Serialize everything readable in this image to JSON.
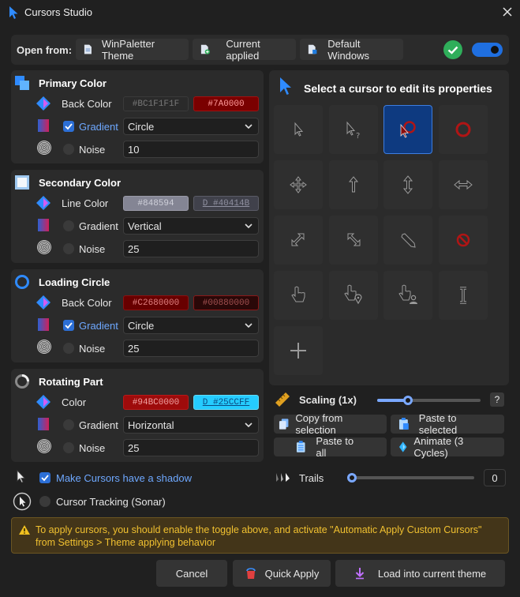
{
  "window": {
    "title": "Cursors Studio"
  },
  "top": {
    "open_from": "Open from:",
    "buttons": [
      "WinPaletter Theme",
      "Current applied",
      "Default Windows"
    ]
  },
  "primary": {
    "title": "Primary Color",
    "back_color_label": "Back Color",
    "color1": "#BC1F1F1F",
    "color1_hex": "#1F1F1F",
    "color2": "#7A0000",
    "color2_hex": "#7A0000",
    "gradient_label": "Gradient",
    "gradient_value": "Circle",
    "noise_label": "Noise",
    "noise_value": "10"
  },
  "secondary": {
    "title": "Secondary Color",
    "line_color_label": "Line Color",
    "color1": "#848594",
    "color1_hex": "#848594",
    "color2": "D #40414B",
    "color2_hex": "#40414B",
    "gradient_label": "Gradient",
    "gradient_value": "Vertical",
    "noise_label": "Noise",
    "noise_value": "25"
  },
  "loading": {
    "title": "Loading Circle",
    "back_color_label": "Back Color",
    "color1": "#C2680000",
    "color1_hex": "#680000",
    "color2": "#00880000",
    "color2_hex": "#2a0808",
    "gradient_label": "Gradient",
    "gradient_value": "Circle",
    "noise_label": "Noise",
    "noise_value": "25"
  },
  "rotating": {
    "title": "Rotating Part",
    "color_label": "Color",
    "color1": "#94BC0000",
    "color1_hex": "#9E0B0B",
    "color2": "D #25CCFF",
    "color2_hex": "#25CCFF",
    "gradient_label": "Gradient",
    "gradient_value": "Horizontal",
    "noise_label": "Noise",
    "noise_value": "25"
  },
  "shadow": {
    "label": "Make Cursors have a shadow"
  },
  "tracking": {
    "label": "Cursor Tracking (Sonar)"
  },
  "cursor_panel": {
    "title": "Select a cursor to edit its properties"
  },
  "scaling": {
    "label": "Scaling (1x)",
    "level": 0.3,
    "help": "?"
  },
  "actions": {
    "copy": "Copy from selection",
    "paste_selected": "Paste to selected",
    "paste_all": "Paste to all",
    "animate": "Animate (3 Cycles)"
  },
  "trails": {
    "label": "Trails",
    "value": "0",
    "level": 0
  },
  "warning": {
    "text": "To apply cursors, you should enable the toggle above, and activate \"Automatic Apply Custom Cursors\" from Settings > Theme applying behavior"
  },
  "footer": {
    "cancel": "Cancel",
    "quick_apply": "Quick Apply",
    "load": "Load into current theme"
  }
}
